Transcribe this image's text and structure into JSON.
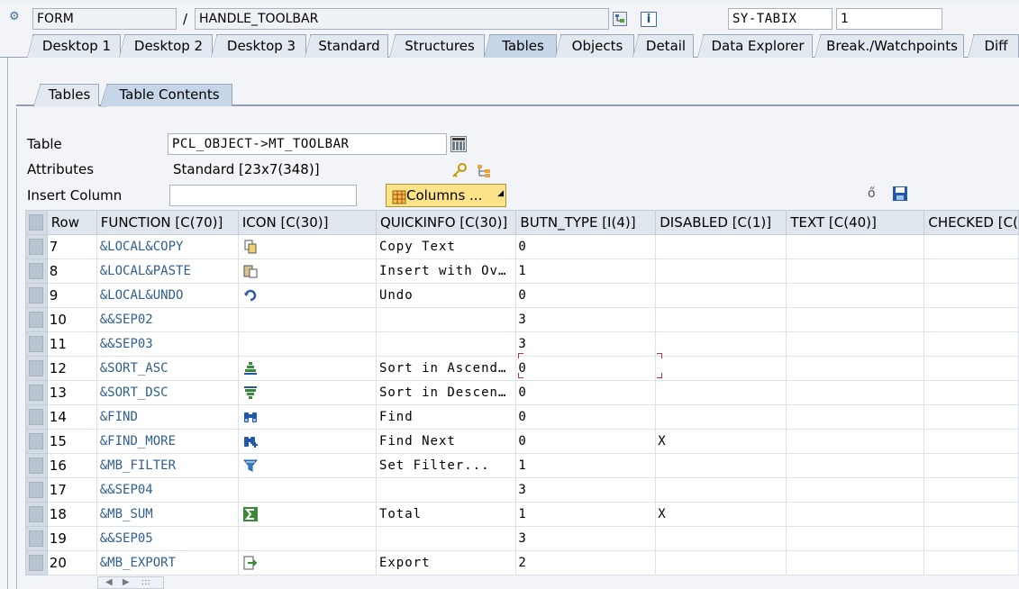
{
  "header": {
    "type_field": "FORM",
    "separator": "/",
    "name_field": "HANDLE_TOOLBAR",
    "var_field": "SY-TABIX",
    "var_value": "1"
  },
  "main_tabs": [
    {
      "label": "Desktop 1"
    },
    {
      "label": "Desktop 2"
    },
    {
      "label": "Desktop 3"
    },
    {
      "label": "Standard"
    },
    {
      "label": "Structures"
    },
    {
      "label": "Tables"
    },
    {
      "label": "Objects"
    },
    {
      "label": "Detail"
    },
    {
      "label": "Data Explorer"
    },
    {
      "label": "Break./Watchpoints"
    },
    {
      "label": "Diff"
    }
  ],
  "sub_tabs": [
    {
      "label": "Tables"
    },
    {
      "label": "Table Contents"
    }
  ],
  "form": {
    "table_label": "Table",
    "table_value": "PCL_OBJECT->MT_TOOLBAR",
    "attributes_label": "Attributes",
    "attributes_value": "Standard [23x7(348)]",
    "insert_column_label": "Insert Column",
    "insert_column_value": "",
    "columns_button": "Columns ..."
  },
  "grid": {
    "headers": [
      "Row",
      "FUNCTION [C(70)]",
      "ICON [C(30)]",
      "QUICKINFO [C(30)]",
      "BUTN_TYPE [I(4)]",
      "DISABLED [C(1)]",
      "TEXT [C(40)]",
      "CHECKED [C("
    ],
    "rows": [
      {
        "row": "7",
        "function": "&LOCAL&COPY",
        "icon": "copy-icon",
        "quickinfo": "Copy Text",
        "butn_type": "0",
        "disabled": "",
        "text": "",
        "checked": ""
      },
      {
        "row": "8",
        "function": "&LOCAL&PASTE",
        "icon": "paste-icon",
        "quickinfo": "Insert with Ov…",
        "butn_type": "1",
        "disabled": "",
        "text": "",
        "checked": ""
      },
      {
        "row": "9",
        "function": "&LOCAL&UNDO",
        "icon": "undo-icon",
        "quickinfo": "Undo",
        "butn_type": "0",
        "disabled": "",
        "text": "",
        "checked": ""
      },
      {
        "row": "10",
        "function": "&&SEP02",
        "icon": "",
        "quickinfo": "",
        "butn_type": "3",
        "disabled": "",
        "text": "",
        "checked": ""
      },
      {
        "row": "11",
        "function": "&&SEP03",
        "icon": "",
        "quickinfo": "",
        "butn_type": "3",
        "disabled": "",
        "text": "",
        "checked": ""
      },
      {
        "row": "12",
        "function": "&SORT_ASC",
        "icon": "sort-asc-icon",
        "quickinfo": "Sort in Ascend…",
        "butn_type": "0",
        "disabled": "",
        "text": "",
        "checked": ""
      },
      {
        "row": "13",
        "function": "&SORT_DSC",
        "icon": "sort-desc-icon",
        "quickinfo": "Sort in Descen…",
        "butn_type": "0",
        "disabled": "",
        "text": "",
        "checked": ""
      },
      {
        "row": "14",
        "function": "&FIND",
        "icon": "binoculars-icon",
        "quickinfo": "Find",
        "butn_type": "0",
        "disabled": "",
        "text": "",
        "checked": ""
      },
      {
        "row": "15",
        "function": "&FIND_MORE",
        "icon": "find-next-icon",
        "quickinfo": "Find Next",
        "butn_type": "0",
        "disabled": "X",
        "text": "",
        "checked": ""
      },
      {
        "row": "16",
        "function": "&MB_FILTER",
        "icon": "filter-icon",
        "quickinfo": "Set Filter...",
        "butn_type": "1",
        "disabled": "",
        "text": "",
        "checked": ""
      },
      {
        "row": "17",
        "function": "&&SEP04",
        "icon": "",
        "quickinfo": "",
        "butn_type": "3",
        "disabled": "",
        "text": "",
        "checked": ""
      },
      {
        "row": "18",
        "function": "&MB_SUM",
        "icon": "sum-icon",
        "quickinfo": "Total",
        "butn_type": "1",
        "disabled": "X",
        "text": "",
        "checked": ""
      },
      {
        "row": "19",
        "function": "&&SEP05",
        "icon": "",
        "quickinfo": "",
        "butn_type": "3",
        "disabled": "",
        "text": "",
        "checked": ""
      },
      {
        "row": "20",
        "function": "&MB_EXPORT",
        "icon": "export-icon",
        "quickinfo": "Export",
        "butn_type": "2",
        "disabled": "",
        "text": "",
        "checked": ""
      }
    ]
  },
  "scrollbar": {
    "left": "◀",
    "right": "▶",
    "grip": ":::"
  }
}
